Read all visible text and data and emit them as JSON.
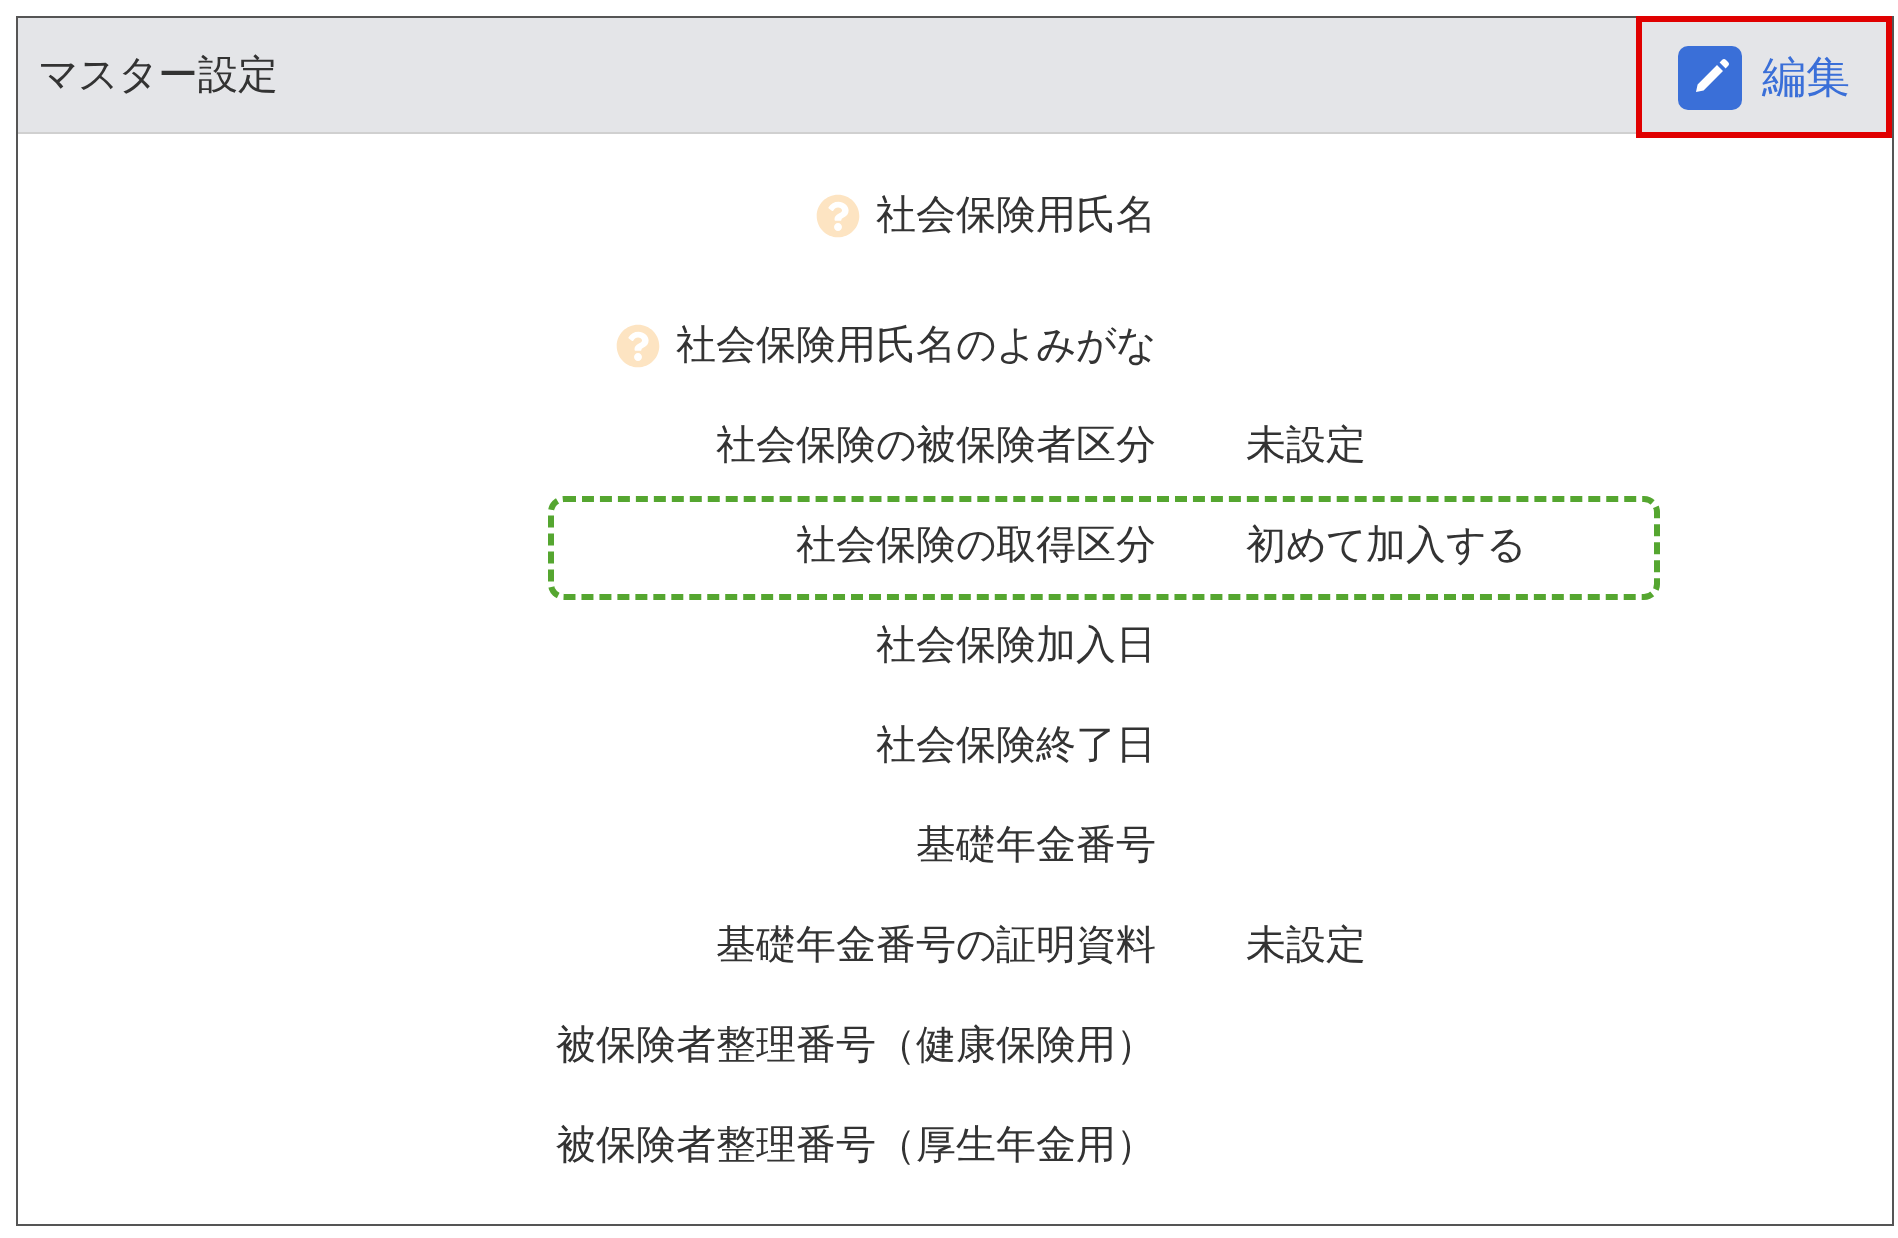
{
  "panel": {
    "title": "マスター設定",
    "edit_button": {
      "label": "編集",
      "highlighted": true
    }
  },
  "fields": [
    {
      "label": "社会保険用氏名",
      "help": true,
      "highlighted": false
    },
    {
      "label": "社会保険用氏名のよみがな",
      "help": true,
      "highlighted": false
    },
    {
      "label": "社会保険の被保険者区分",
      "value": "未設定",
      "help": false,
      "highlighted": false
    },
    {
      "label": "社会保険の取得区分",
      "value": "初めて加入する",
      "help": false,
      "highlighted": true
    },
    {
      "label": "社会保険加入日",
      "help": false,
      "highlighted": false
    },
    {
      "label": "社会保険終了日",
      "help": false,
      "highlighted": false
    },
    {
      "label": "基礎年金番号",
      "help": false,
      "highlighted": false
    },
    {
      "label": "基礎年金番号の証明資料",
      "value": "未設定",
      "help": false,
      "highlighted": false
    },
    {
      "label": "被保険者整理番号（健康保険用）",
      "help": false,
      "highlighted": false
    },
    {
      "label": "被保険者整理番号（厚生年金用）",
      "help": false,
      "highlighted": false
    }
  ]
}
